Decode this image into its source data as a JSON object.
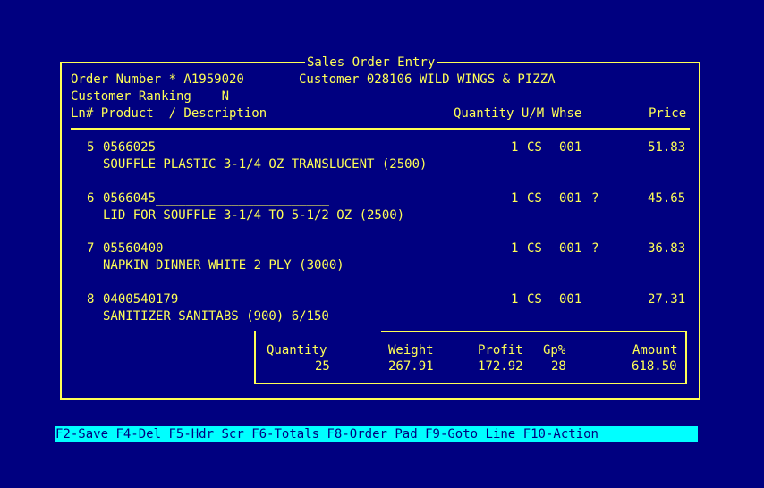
{
  "header": {
    "title": "Sales Order Entry",
    "order_label": "Order Number * A1959020",
    "customer_label": "Customer 028106 WILD WINGS & PIZZA",
    "ranking_label": "Customer Ranking    N"
  },
  "columns": {
    "ln_product": "Ln# Product  / Description",
    "qty_um_whse": "Quantity U/M Whse",
    "price": "Price"
  },
  "lines": [
    {
      "ln": "5",
      "product": "0566025",
      "description": "SOUFFLE PLASTIC 3-1/4 OZ TRANSLUCENT (2500)",
      "qty": "1",
      "um": "CS",
      "whse": "001",
      "flag": "",
      "price": "51.83"
    },
    {
      "ln": "6",
      "product": "0566045",
      "product_fill": "_______________________",
      "description": "LID FOR SOUFFLE 3-1/4 TO 5-1/2 OZ (2500)",
      "qty": "1",
      "um": "CS",
      "whse": "001",
      "flag": "?",
      "price": "45.65"
    },
    {
      "ln": "7",
      "product": "05560400",
      "description": "NAPKIN DINNER WHITE 2 PLY (3000)",
      "qty": "1",
      "um": "CS",
      "whse": "001",
      "flag": "?",
      "price": "36.83"
    },
    {
      "ln": "8",
      "product": "0400540179",
      "description": "SANITIZER SANITABS (900) 6/150",
      "qty": "1",
      "um": "CS",
      "whse": "001",
      "flag": "",
      "price": "27.31"
    }
  ],
  "totals": {
    "quantity_label": "Quantity",
    "quantity": "25",
    "weight_label": "Weight",
    "weight": "267.91",
    "profit_label": "Profit",
    "profit": "172.92",
    "gp_label": "Gp%",
    "gp": "28",
    "amount_label": "Amount",
    "amount": "618.50"
  },
  "function_keys": [
    "F2-Save",
    "F4-Del",
    "F5-Hdr Scr",
    "F6-Totals",
    "F8-Order Pad",
    "F9-Goto Line",
    "F10-Action"
  ],
  "colors": {
    "background": "#000080",
    "foreground": "#ffff55",
    "funcbar_bg": "#00ffff",
    "funcbar_fg": "#000080"
  }
}
